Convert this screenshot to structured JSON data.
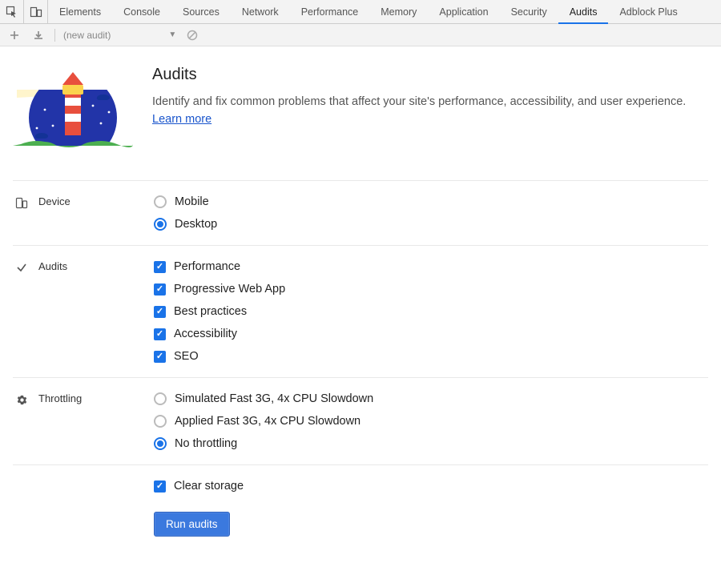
{
  "tabs": [
    "Elements",
    "Console",
    "Sources",
    "Network",
    "Performance",
    "Memory",
    "Application",
    "Security",
    "Audits",
    "Adblock Plus"
  ],
  "active_tab": "Audits",
  "toolbar": {
    "audit_dropdown": "(new audit)"
  },
  "header": {
    "title": "Audits",
    "subtitle_text": "Identify and fix common problems that affect your site's performance, accessibility, and user experience. ",
    "learn_more": "Learn more"
  },
  "sections": {
    "device": {
      "label": "Device",
      "options": [
        {
          "label": "Mobile",
          "checked": false
        },
        {
          "label": "Desktop",
          "checked": true
        }
      ]
    },
    "audits": {
      "label": "Audits",
      "options": [
        {
          "label": "Performance",
          "checked": true
        },
        {
          "label": "Progressive Web App",
          "checked": true
        },
        {
          "label": "Best practices",
          "checked": true
        },
        {
          "label": "Accessibility",
          "checked": true
        },
        {
          "label": "SEO",
          "checked": true
        }
      ]
    },
    "throttling": {
      "label": "Throttling",
      "options": [
        {
          "label": "Simulated Fast 3G, 4x CPU Slowdown",
          "checked": false
        },
        {
          "label": "Applied Fast 3G, 4x CPU Slowdown",
          "checked": false
        },
        {
          "label": "No throttling",
          "checked": true
        }
      ]
    },
    "extra": {
      "clear_storage": {
        "label": "Clear storage",
        "checked": true
      }
    }
  },
  "actions": {
    "run": "Run audits"
  }
}
